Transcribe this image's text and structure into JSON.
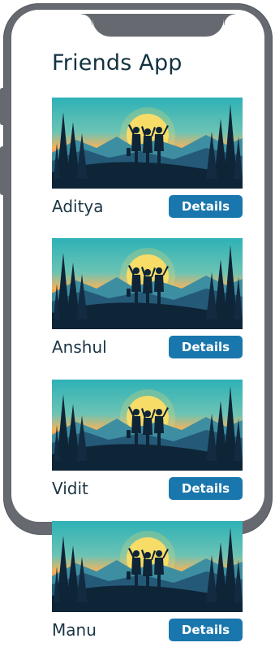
{
  "app": {
    "title": "Friends App",
    "button_label": "Details"
  },
  "friends": [
    {
      "name": "Aditya"
    },
    {
      "name": "Anshul"
    },
    {
      "name": "Vidit"
    },
    {
      "name": "Manu"
    }
  ],
  "colors": {
    "frame": "#666a70",
    "title_text": "#123241",
    "button_bg": "#1a77ad",
    "sky_top": "#3cb8bd",
    "sun": "#f7dc68",
    "silhouette": "#0e2437"
  }
}
